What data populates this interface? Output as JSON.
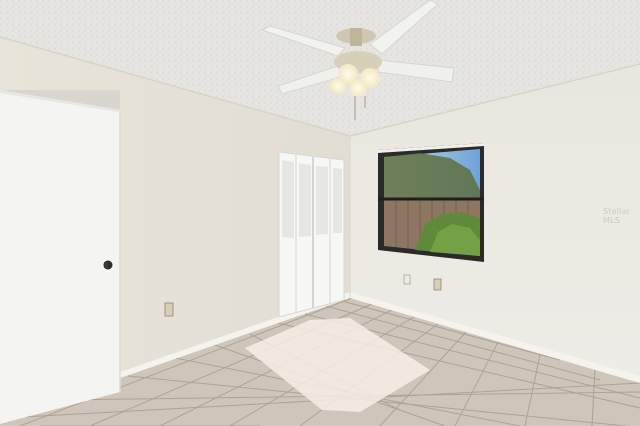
{
  "scene": {
    "kind": "empty bedroom interior photo",
    "objects": [
      "textured-ceiling",
      "ceiling-fan-with-light",
      "white-door",
      "bifold-louvered-closet",
      "window-with-fence-view",
      "beige-tile-floor",
      "baseboard",
      "electrical-outlets"
    ]
  },
  "watermark": "Stellar MLS",
  "colors": {
    "ceiling": "#e6e5e1",
    "wall_left": "#e7e2d8",
    "wall_back": "#ecebe4",
    "wall_right": "#ecebe6",
    "floor": "#cfc6b9",
    "grout": "#a79d90",
    "door": "#f4f4f3",
    "closet": "#f7f7f5",
    "window_frame": "#2a2a2a",
    "fence": "#8d7763",
    "foliage": "#5f8a3a",
    "sky": "#a9c7e4"
  }
}
